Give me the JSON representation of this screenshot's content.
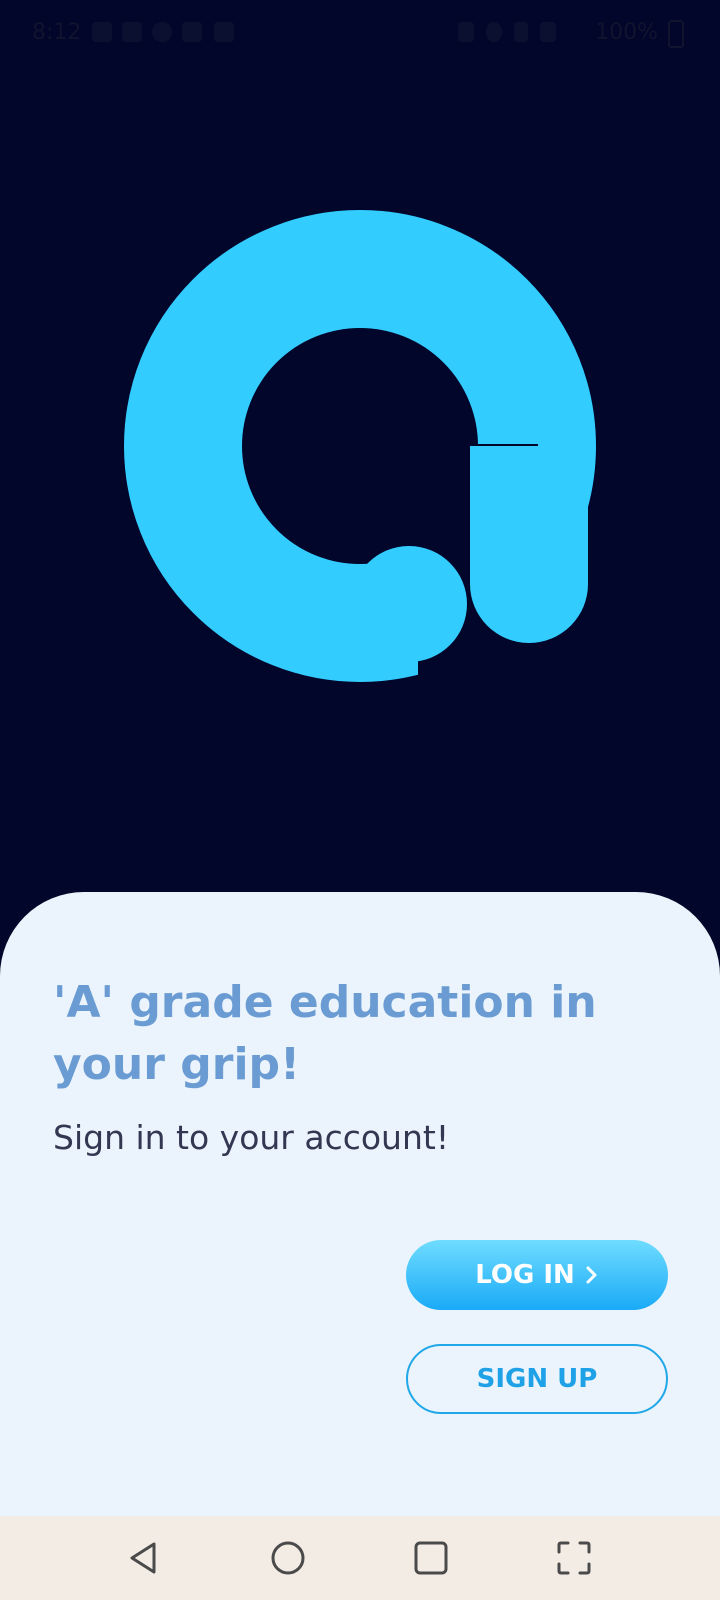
{
  "status_bar": {
    "time": "8:12",
    "battery": "100%",
    "icons": [
      "facebook-icon",
      "mail-icon",
      "app-logo-icon",
      "message-icon",
      "message-icon",
      "mute-icon",
      "alarm-icon",
      "signal-icon",
      "wifi-icon",
      "battery-icon"
    ]
  },
  "brand": {
    "logo_icon": "app-logo-icon",
    "logo_color": "#33ccff",
    "background_color": "#02062a"
  },
  "welcome": {
    "headline": "'A' grade education in your grip!",
    "subtitle": "Sign in to your account!"
  },
  "actions": {
    "login_label": "LOG IN",
    "login_icon": "chevron-right-icon",
    "signup_label": "SIGN UP"
  },
  "nav_bar": {
    "buttons": [
      "back-icon",
      "home-icon",
      "recents-icon",
      "screenshot-icon"
    ]
  }
}
